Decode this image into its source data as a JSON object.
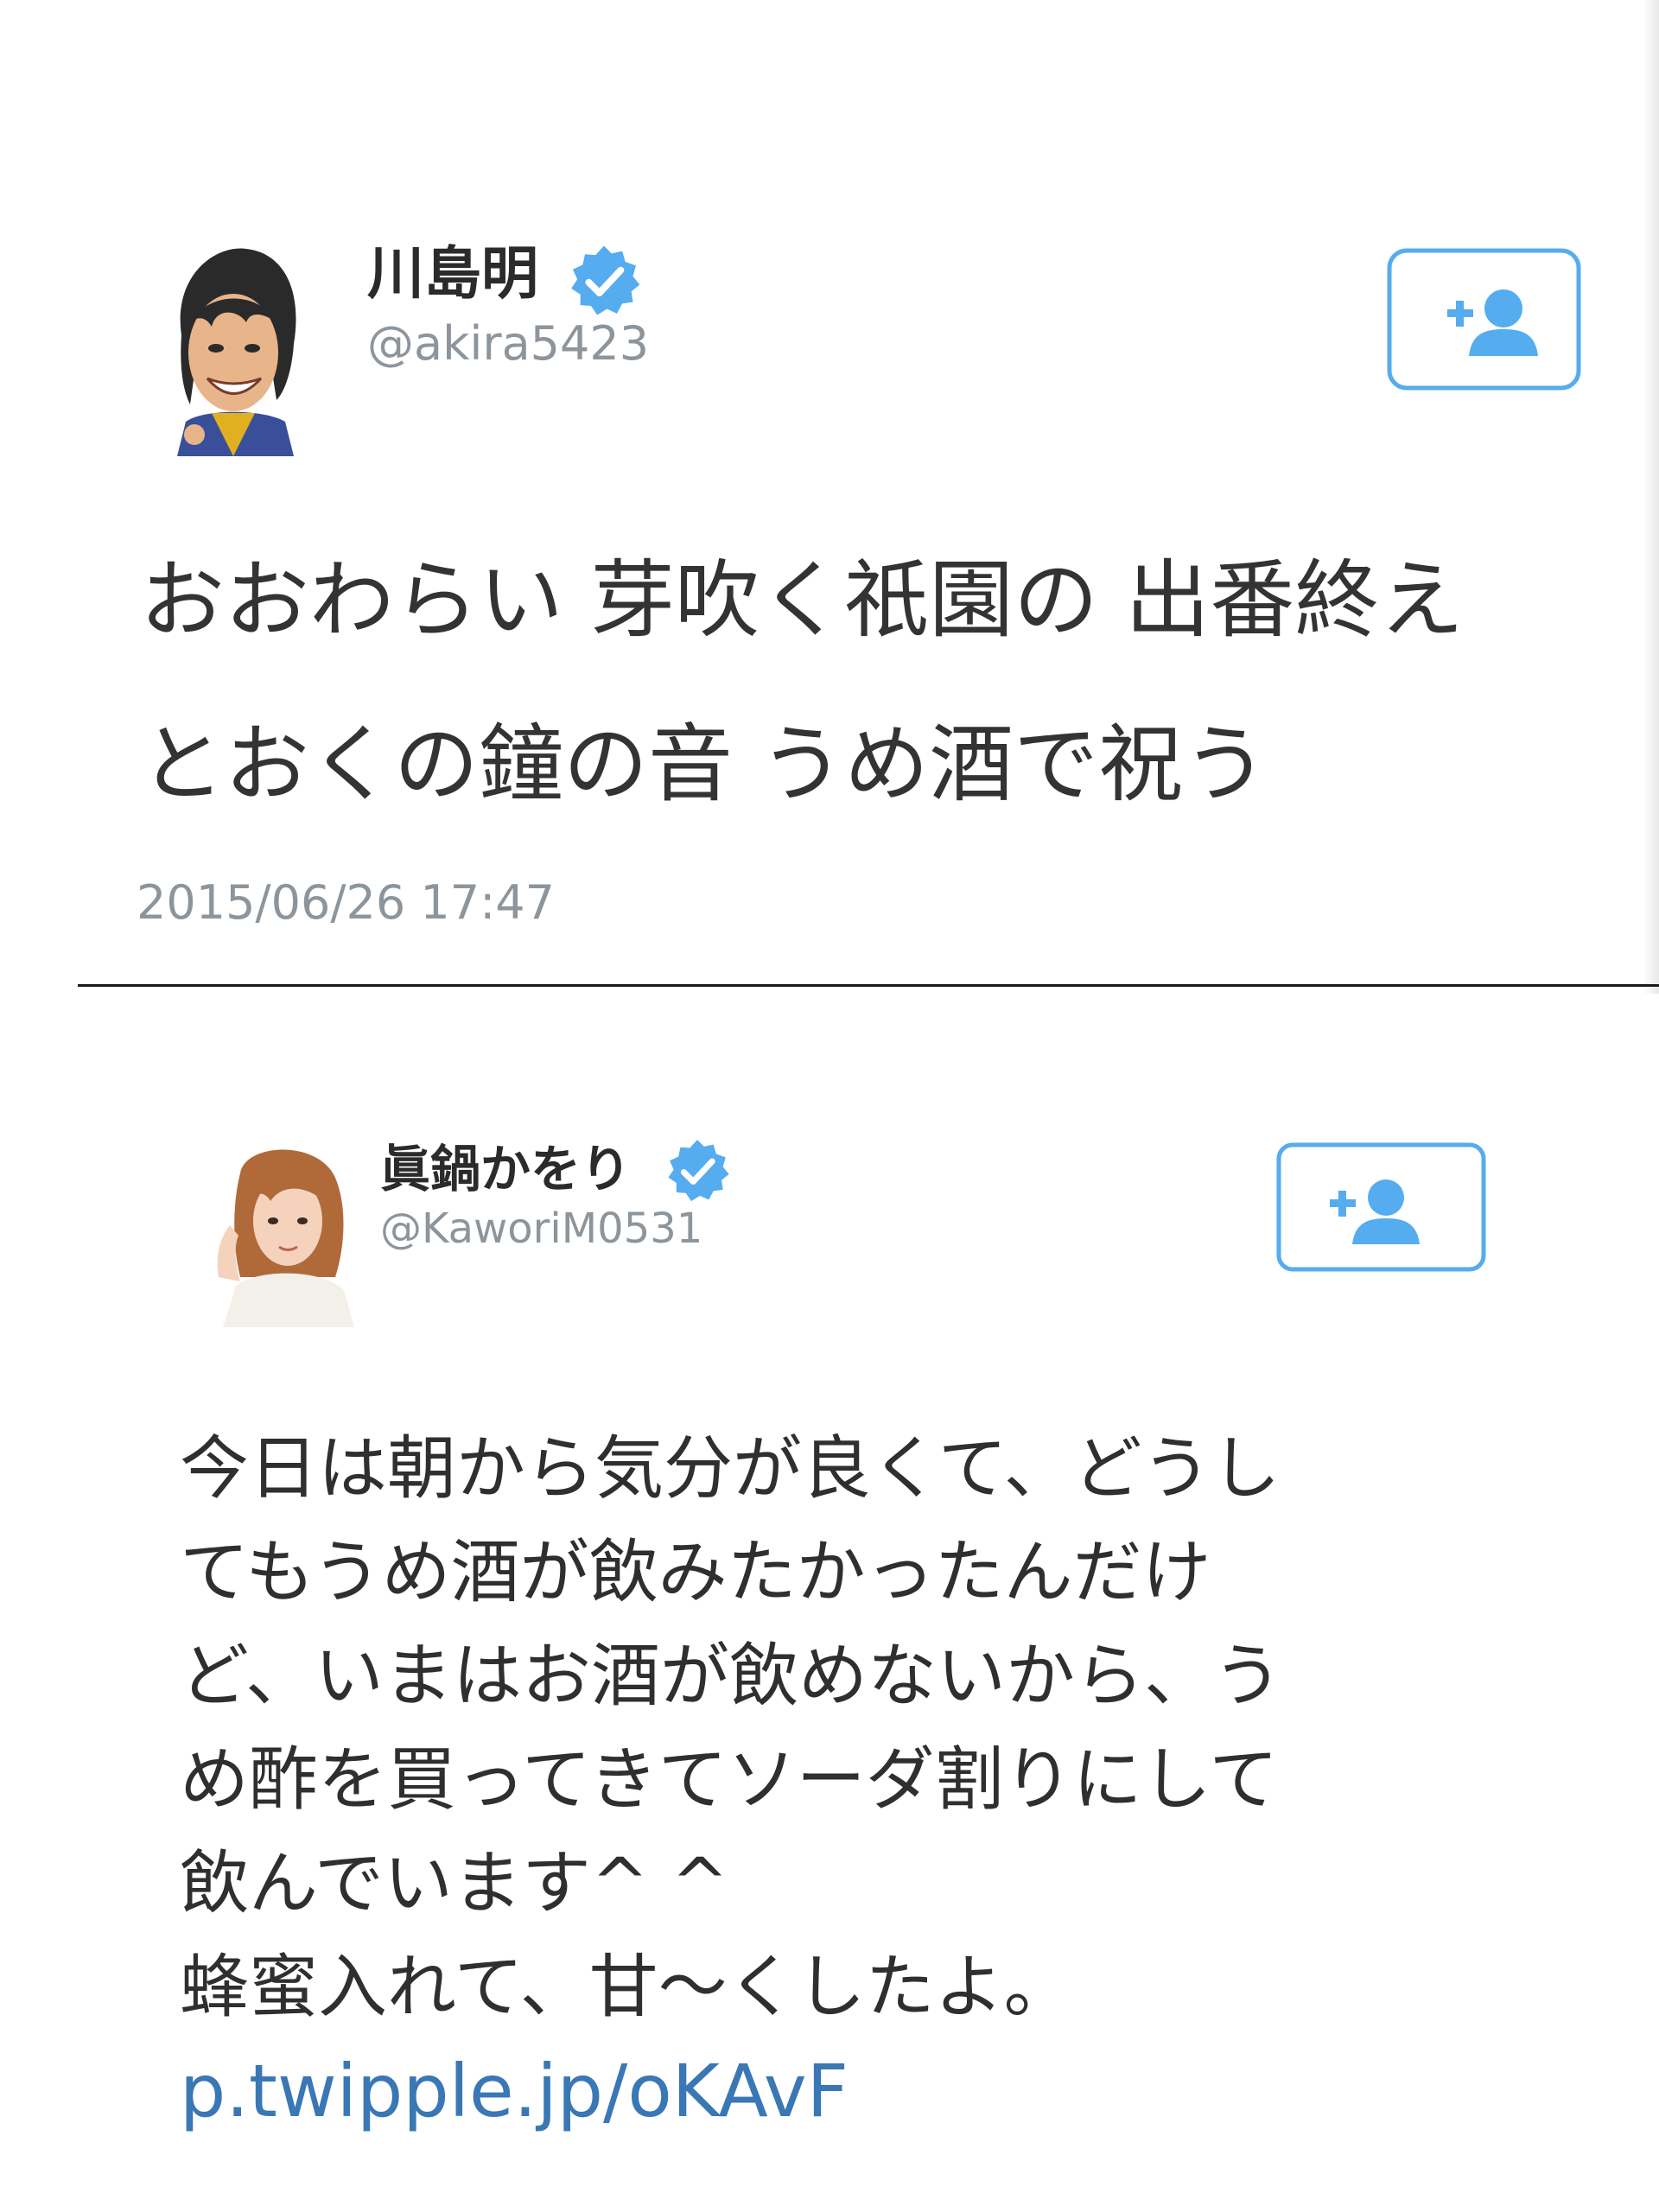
{
  "tweets": [
    {
      "display_name": "川島明",
      "handle": "@akira5423",
      "verified": true,
      "body_lines": [
        "おおわらい 芽吹く祇園の 出番終え",
        "とおくの鐘の音 うめ酒で祝う"
      ],
      "timestamp": "2015/06/26 17:47"
    },
    {
      "display_name": "眞鍋かをり",
      "handle": "@KaworiM0531",
      "verified": true,
      "body_lines": [
        "今日は朝から気分が良くて、どうし",
        "てもうめ酒が飲みたかったんだけ",
        "ど、いまはお酒が飲めないから、う",
        "め酢を買ってきてソーダ割りにして",
        "飲んでいます^ ^",
        "蜂蜜入れて、甘〜くしたよ。"
      ],
      "link": "p.twipple.jp/oKAvF"
    }
  ],
  "icons": {
    "verified": "verified-badge-icon",
    "follow": "add-user-icon"
  },
  "colors": {
    "accent": "#55acee",
    "link": "#3a77b5",
    "muted": "#8d959c",
    "text": "#333333"
  }
}
